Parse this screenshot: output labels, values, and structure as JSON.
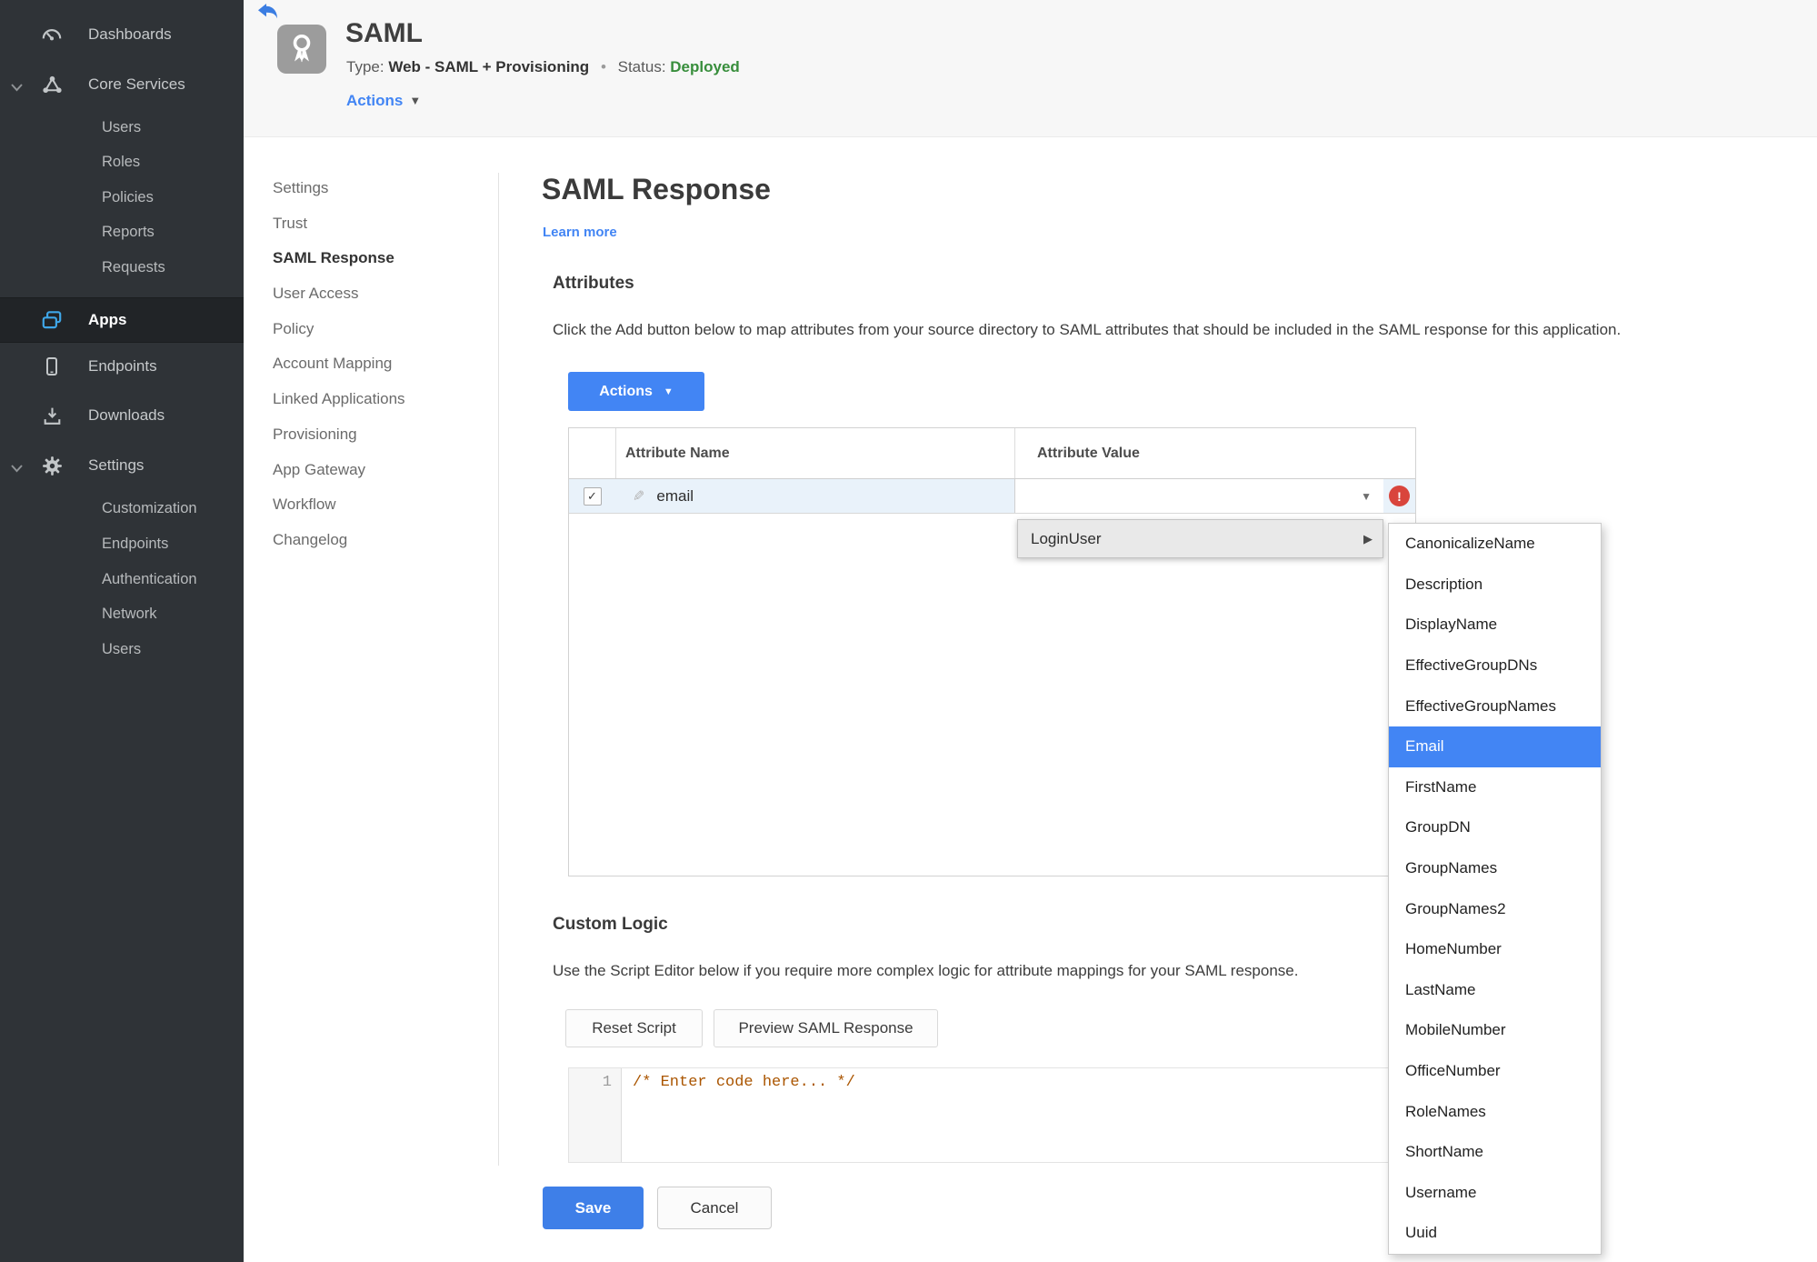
{
  "colors": {
    "accent_blue": "#4285f4",
    "status_green": "#388e3c",
    "error_red": "#d9453c",
    "sidebar_bg": "#2f3337",
    "selection_blue": "#4285f4",
    "row_highlight": "#e9f2fa",
    "code_comment": "#aa5500"
  },
  "sidebar": {
    "items": {
      "dashboards": "Dashboards",
      "core_services": "Core Services",
      "core_children": [
        "Users",
        "Roles",
        "Policies",
        "Reports",
        "Requests"
      ],
      "apps": "Apps",
      "endpoints": "Endpoints",
      "downloads": "Downloads",
      "settings": "Settings",
      "settings_children": [
        "Customization",
        "Endpoints",
        "Authentication",
        "Network",
        "Users"
      ]
    }
  },
  "header": {
    "title": "SAML",
    "type_label": "Type:",
    "type_value": "Web - SAML + Provisioning",
    "separator": "•",
    "status_label": "Status:",
    "status_value": "Deployed",
    "actions_label": "Actions"
  },
  "subnav": {
    "active": "SAML Response",
    "items": [
      "Settings",
      "Trust",
      "SAML Response",
      "User Access",
      "Policy",
      "Account Mapping",
      "Linked Applications",
      "Provisioning",
      "App Gateway",
      "Workflow",
      "Changelog"
    ]
  },
  "main": {
    "title": "SAML Response",
    "learn_more": "Learn more",
    "attributes": {
      "heading": "Attributes",
      "description": "Click the Add button below to map attributes from your source directory to SAML attributes that should be included in the SAML response for this application.",
      "actions_button": "Actions",
      "table": {
        "columns": [
          "Attribute Name",
          "Attribute Value"
        ],
        "rows": [
          {
            "checked": "✓",
            "name": "email",
            "value": ""
          }
        ]
      }
    },
    "custom_logic": {
      "heading": "Custom Logic",
      "description": "Use the Script Editor below if you require more complex logic for attribute mappings for your SAML response.",
      "reset_button": "Reset Script",
      "preview_button": "Preview SAML Response",
      "editor": {
        "line_number": "1",
        "code": "/* Enter code here... */"
      }
    },
    "save_button": "Save",
    "cancel_button": "Cancel"
  },
  "value_menu": {
    "trigger": "LoginUser",
    "selected": "Email",
    "options": [
      "CanonicalizeName",
      "Description",
      "DisplayName",
      "EffectiveGroupDNs",
      "EffectiveGroupNames",
      "Email",
      "FirstName",
      "GroupDN",
      "GroupNames",
      "GroupNames2",
      "HomeNumber",
      "LastName",
      "MobileNumber",
      "OfficeNumber",
      "RoleNames",
      "ShortName",
      "Username",
      "Uuid"
    ]
  }
}
